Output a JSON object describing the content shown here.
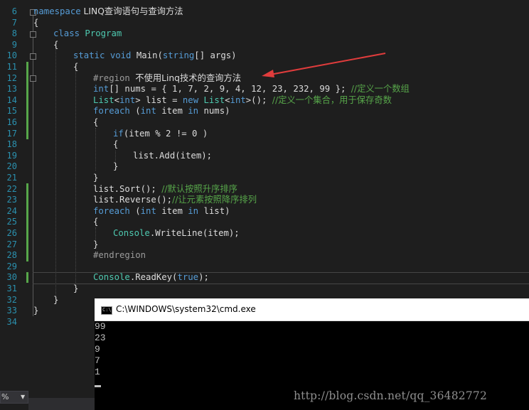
{
  "editor": {
    "line_numbers": [
      "6",
      "7",
      "8",
      "9",
      "10",
      "11",
      "12",
      "13",
      "14",
      "15",
      "16",
      "17",
      "18",
      "19",
      "20",
      "21",
      "22",
      "23",
      "24",
      "25",
      "26",
      "27",
      "28",
      "29",
      "30",
      "31",
      "32",
      "33",
      "34"
    ],
    "code": {
      "l6_kw": "namespace",
      "l6_name": " LINQ查询语句与查询方法",
      "l7": "{",
      "l8_kw": "class",
      "l8_name": " Program",
      "l9": "{",
      "l10_kw1": "static",
      "l10_kw2": " void",
      "l10_a": " Main(",
      "l10_kw3": "string",
      "l10_b": "[] args)",
      "l11": "{",
      "l12_a": "#region ",
      "l12_b": "不使用Linq技术的查询方法",
      "l13_kw": "int",
      "l13_a": "[] nums = { 1, 7, 2, 9, 4, 12, 23, 232, 99 }; ",
      "l13_cm": "//定义一个数组",
      "l14_ty1": "List",
      "l14_a": "<",
      "l14_kw1": "int",
      "l14_b": "> list = ",
      "l14_kw2": "new",
      "l14_sp": " ",
      "l14_ty2": "List",
      "l14_c": "<",
      "l14_kw3": "int",
      "l14_d": ">(); ",
      "l14_cm": "//定义一个集合，用于保存奇数",
      "l15_kw1": "foreach",
      "l15_a": " (",
      "l15_kw2": "int",
      "l15_b": " item ",
      "l15_kw3": "in",
      "l15_c": " nums)",
      "l16": "{",
      "l17_kw": "if",
      "l17_a": "(item % 2 != 0 )",
      "l18": "{",
      "l19": "list.Add(item);",
      "l20": "}",
      "l21": "}",
      "l22_a": "list.Sort(); ",
      "l22_cm": "//默认按照升序排序",
      "l23_a": "list.Reverse();",
      "l23_cm": "//让元素按照降序排列",
      "l24_kw1": "foreach",
      "l24_a": " (",
      "l24_kw2": "int",
      "l24_b": " item ",
      "l24_kw3": "in",
      "l24_c": " list)",
      "l25": "{",
      "l26_ty": "Console",
      "l26_a": ".WriteLine(item);",
      "l27": "}",
      "l28": "#endregion",
      "l30_ty": "Console",
      "l30_a": ".ReadKey(",
      "l30_kw": "true",
      "l30_b": ");",
      "l31": "}",
      "l32": "}",
      "l33": "}"
    }
  },
  "cmd": {
    "title": "C:\\WINDOWS\\system32\\cmd.exe",
    "icon_text": "C:\\",
    "output": [
      "99",
      "23",
      "9",
      "7",
      "1"
    ]
  },
  "statusbar": {
    "zoom": "%"
  },
  "watermark": "http://blog.csdn.net/qq_36482772",
  "colors": {
    "keyword": "#569cd6",
    "type": "#4ec9b0",
    "comment": "#57a64a",
    "annotation_arrow": "#e03c3c"
  }
}
